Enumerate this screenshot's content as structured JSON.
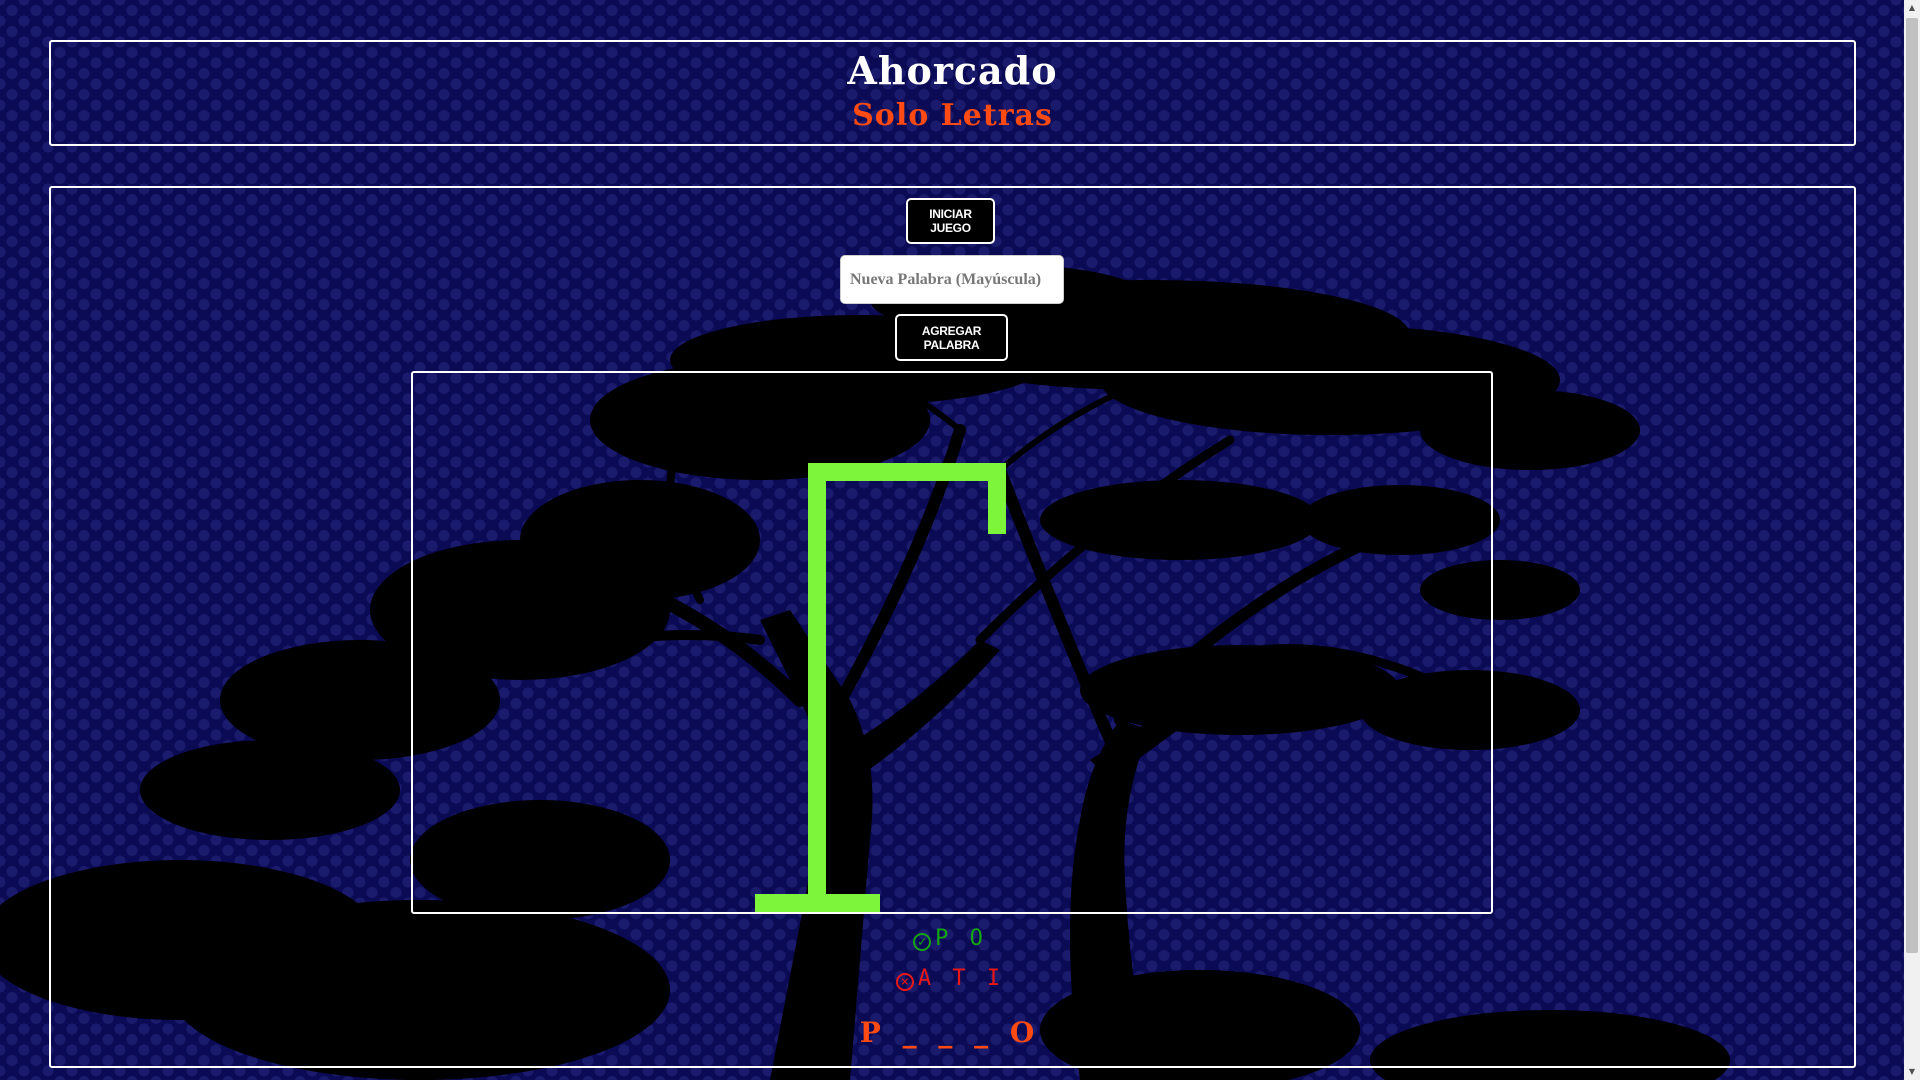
{
  "header": {
    "title": "Ahorcado",
    "subtitle": "Solo Letras"
  },
  "controls": {
    "start_label": "Iniciar Juego",
    "new_word_placeholder": "Nueva Palabra (Mayúscula)",
    "new_word_value": "",
    "add_label": "Agregar Palabra"
  },
  "game": {
    "correct_letters": "P O",
    "wrong_letters": "A T I",
    "word_display": "P _ _ _ O",
    "gallows_color": "#7cf53a",
    "correct_color": "#14a514",
    "wrong_color": "#e81818",
    "accent_color": "#ff4a14"
  },
  "icons": {
    "correct": "check-circle-icon",
    "wrong": "x-circle-icon"
  }
}
